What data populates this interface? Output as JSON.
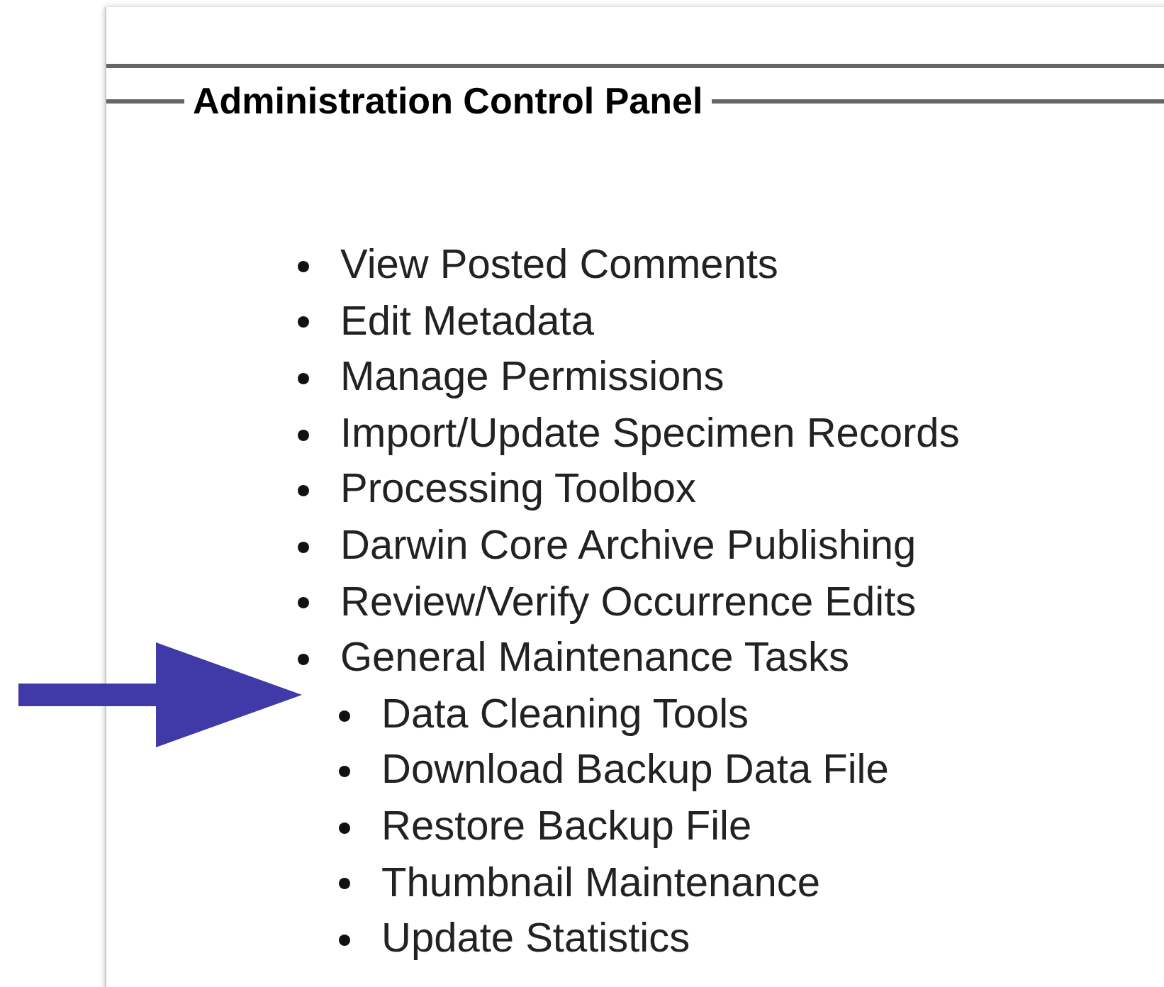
{
  "panel": {
    "title": "Administration Control Panel",
    "items": [
      {
        "label": "View Posted Comments"
      },
      {
        "label": "Edit Metadata"
      },
      {
        "label": "Manage Permissions"
      },
      {
        "label": "Import/Update Specimen Records"
      },
      {
        "label": "Processing Toolbox"
      },
      {
        "label": "Darwin Core Archive Publishing"
      },
      {
        "label": "Review/Verify Occurrence Edits"
      },
      {
        "label": "General Maintenance Tasks",
        "children": [
          {
            "label": "Data Cleaning Tools"
          },
          {
            "label": "Download Backup Data File"
          },
          {
            "label": "Restore Backup File"
          },
          {
            "label": "Thumbnail Maintenance"
          },
          {
            "label": "Update Statistics"
          }
        ]
      }
    ]
  }
}
